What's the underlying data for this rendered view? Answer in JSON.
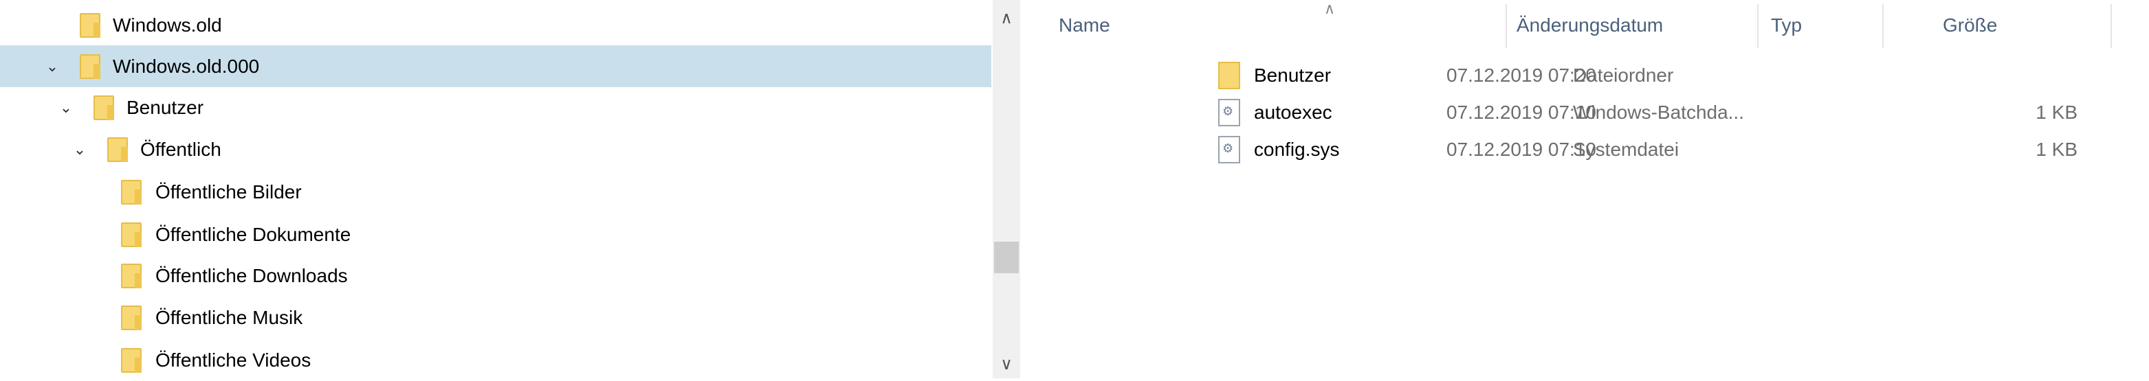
{
  "tree": {
    "items": [
      {
        "label": "Windows.old",
        "expanded": null,
        "selected": false,
        "level": 0
      },
      {
        "label": "Windows.old.000",
        "expanded": true,
        "selected": true,
        "level": 0
      },
      {
        "label": "Benutzer",
        "expanded": true,
        "selected": false,
        "level": 1
      },
      {
        "label": "Öffentlich",
        "expanded": true,
        "selected": false,
        "level": 2
      },
      {
        "label": "Öffentliche Bilder",
        "level": 3
      },
      {
        "label": "Öffentliche Dokumente",
        "level": 3
      },
      {
        "label": "Öffentliche Downloads",
        "level": 3
      },
      {
        "label": "Öffentliche Musik",
        "level": 3
      },
      {
        "label": "Öffentliche Videos",
        "level": 3
      }
    ]
  },
  "list": {
    "columns": {
      "name": "Name",
      "date": "Änderungsdatum",
      "type": "Typ",
      "size": "Größe"
    },
    "rows": [
      {
        "name": "Benutzer",
        "date": "07.12.2019 07:20",
        "type": "Dateiordner",
        "size": "",
        "icon": "folder-icon"
      },
      {
        "name": "autoexec",
        "date": "07.12.2019 07:10",
        "type": "Windows-Batchda...",
        "size": "1 KB",
        "icon": "batch-file-icon"
      },
      {
        "name": "config.sys",
        "date": "07.12.2019 07:10",
        "type": "Systemdatei",
        "size": "1 KB",
        "icon": "system-file-icon"
      }
    ]
  },
  "icons": {
    "up": "^",
    "down": "v",
    "chevron": "⌄",
    "sort": "^"
  }
}
